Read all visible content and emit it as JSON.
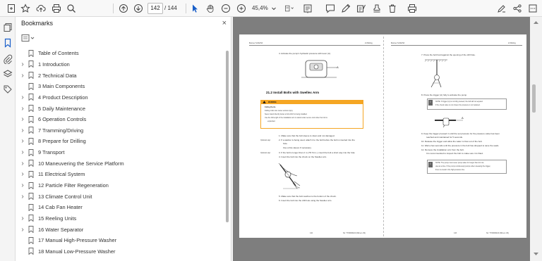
{
  "toolbar": {
    "current_page": "142",
    "total_pages": "/ 144",
    "zoom": "45,4%"
  },
  "bookmarks_panel": {
    "title": "Bookmarks",
    "close": "×",
    "items": [
      {
        "label": "Table of Contents",
        "expandable": false
      },
      {
        "label": "1 Introduction",
        "expandable": true
      },
      {
        "label": "2 Technical Data",
        "expandable": true
      },
      {
        "label": "3 Main Components",
        "expandable": false
      },
      {
        "label": "4 Product Description",
        "expandable": true
      },
      {
        "label": "5 Daily Maintenance",
        "expandable": true
      },
      {
        "label": "6 Operation Controls",
        "expandable": true
      },
      {
        "label": "7 Tramming/Driving",
        "expandable": true
      },
      {
        "label": "8 Prepare for Drilling",
        "expandable": true
      },
      {
        "label": "9 Transport",
        "expandable": true
      },
      {
        "label": "10 Maneuvering the Service Platform",
        "expandable": true
      },
      {
        "label": "11 Electrical System",
        "expandable": true
      },
      {
        "label": "12 Particle Filter Regeneration",
        "expandable": true
      },
      {
        "label": "13 Climate Control Unit",
        "expandable": true
      },
      {
        "label": "14 Cab Fan Heater",
        "expandable": false
      },
      {
        "label": "15 Reeling Units",
        "expandable": true
      },
      {
        "label": "16 Water Separator",
        "expandable": true
      },
      {
        "label": "17 Manual High-Pressure Washer",
        "expandable": false
      },
      {
        "label": "18 Manual Low-Pressure Washer",
        "expandable": false
      }
    ]
  },
  "document": {
    "left_page": {
      "header_left": "Boomer S1/S2/S3",
      "header_right": "21 Bolting",
      "step4": "4.   Activate the pump's hydraulic pressure with lever (A).",
      "section_title": "21.2  Install Bolts with Swellex Arm",
      "warning_label": "WARNING",
      "warning_sub": "Falling Rocks",
      "warning_line1": "Falling rocks can cause serious injury.",
      "warning_line2": "Never stand directly below a bolt which is being installed.",
      "warning_line3": "Use the full length of the installation arm to stand under secure rock when the bolt is",
      "warning_line4": "expanded.",
      "s1": "1.   Make sure that the bolt sleeve is clean and not damaged.",
      "opt1_tag": "Optional step",
      "s2": "2.   If a washer is being used, attach it to the bolt before the bolt is inserted into the",
      "s2b": "hole.",
      "s2c": "Use a bite sleeve if necessary.",
      "opt2_tag": "Optional step",
      "s3": "3.   If the bolt is longer than 2 m (78.74 in.), insert the bolt a short way into the hole",
      "s4": "4.   Insert the bolt into the chuck on the Swellex arm.",
      "s5": "5.   Make sure that the bolt reaches to the bottom of the chuck.",
      "s6": "6.   Insert the bolt into the drill hole using the Swellex arm.",
      "footer_page": "142",
      "footer_doc": "No: TY00000422 (002-en-US)"
    },
    "right_page": {
      "header_left": "Boomer S1/S2/S3",
      "header_right": "21 Bolting",
      "s7": "7.   Press the bolt hard against the opening of the drill hole.",
      "s8": "8.   Press the trigger (A) fully to activate the pump.",
      "note1": "NOTE: If trigger (A) is not fully pressed, the bolt will not expand.",
      "note1b": "If the check valve is not closed, the pressure is not retained.",
      "s9": "9.   Keep the trigger pressed in until the set pressure for the pressure valve has been",
      "s9b": "reached and maintained for 5 seconds.",
      "s10": "10.  Release the trigger and allow the water to flow out of the bolt.",
      "s11": "11.  Wait a few seconds until the pressure in the bolt has dropped to save the seals.",
      "s12": "12.  Remove the installation arm from the bolt.",
      "s12b": "It is recommended to inspect the bolt to make sure it is fitted.",
      "note2": "NOTE: The pump must never pump water for longer than 10 min-",
      "note2b": "utes at a time. If the pump continuously pumps when releasing the trigger,",
      "note2c": "there is a leak in the high-pressure line.",
      "footer_page": "143",
      "footer_doc": "No: TY00000422 (002-en-US)"
    }
  },
  "colors": {
    "accent": "#1a5fc9",
    "warning": "#f5a623",
    "viewer_bg": "#7e7e7e"
  }
}
